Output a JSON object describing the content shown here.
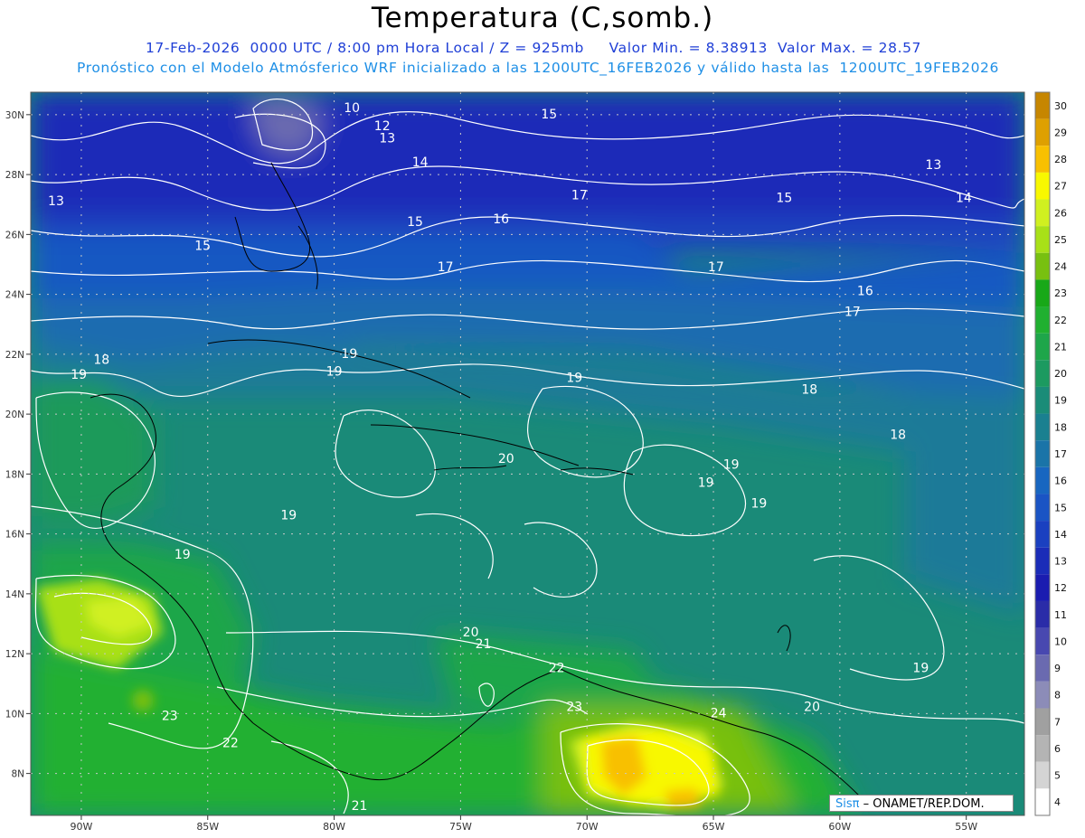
{
  "header": {
    "title": "Temperatura (C,somb.)",
    "date": "17-Feb-2026",
    "utc": "0000 UTC / 8:00 pm Hora Local / Z = 925mb",
    "min": "Valor Min. = 8.38913",
    "max": "Valor Max. = 28.57",
    "forecast": "Pronóstico con el Modelo Atmósferico WRF inicializado a las 1200UTC_16FEB2026 y válido hasta las  1200UTC_19FEB2026"
  },
  "axes": {
    "lon_labels": [
      "90W",
      "85W",
      "80W",
      "75W",
      "70W",
      "65W",
      "60W",
      "55W"
    ],
    "lat_labels": [
      "30N",
      "28N",
      "26N",
      "24N",
      "22N",
      "20N",
      "18N",
      "16N",
      "14N",
      "12N",
      "10N",
      "8N"
    ]
  },
  "colorbar": {
    "labels": [
      "30",
      "29",
      "28",
      "27",
      "26",
      "25",
      "24",
      "23",
      "22",
      "21",
      "20",
      "19",
      "18",
      "17",
      "16",
      "15",
      "14",
      "13",
      "12",
      "11",
      "10",
      "9",
      "8",
      "7",
      "6",
      "5",
      "4"
    ],
    "colors": [
      "#c68600",
      "#dea000",
      "#f8c000",
      "#f8f800",
      "#d0f020",
      "#a8e018",
      "#78c010",
      "#18a818",
      "#20b030",
      "#1ea64a",
      "#1c9a60",
      "#1a8c78",
      "#1a8090",
      "#1a74a8",
      "#1866c0",
      "#1a54c4",
      "#1a40c0",
      "#1a2cb8",
      "#1a1cb0",
      "#2a2ca8",
      "#4848b0",
      "#6a6ab0",
      "#8c8cb8",
      "#a0a0a0",
      "#b4b4b4",
      "#d4d4d4",
      "#ffffff"
    ]
  },
  "contour_labels": [
    {
      "text": "10",
      "lon": -79.3,
      "lat": 30.2
    },
    {
      "text": "12",
      "lon": -78.1,
      "lat": 29.6
    },
    {
      "text": "13",
      "lon": -77.9,
      "lat": 29.2
    },
    {
      "text": "14",
      "lon": -76.6,
      "lat": 28.4
    },
    {
      "text": "15",
      "lon": -71.5,
      "lat": 30.0
    },
    {
      "text": "13",
      "lon": -91.0,
      "lat": 27.1
    },
    {
      "text": "15",
      "lon": -85.2,
      "lat": 25.6
    },
    {
      "text": "15",
      "lon": -76.8,
      "lat": 26.4
    },
    {
      "text": "16",
      "lon": -73.4,
      "lat": 26.5
    },
    {
      "text": "17",
      "lon": -75.6,
      "lat": 24.9
    },
    {
      "text": "17",
      "lon": -70.3,
      "lat": 27.3
    },
    {
      "text": "15",
      "lon": -62.2,
      "lat": 27.2
    },
    {
      "text": "13",
      "lon": -56.3,
      "lat": 28.3
    },
    {
      "text": "14",
      "lon": -55.1,
      "lat": 27.2
    },
    {
      "text": "17",
      "lon": -64.9,
      "lat": 24.9
    },
    {
      "text": "16",
      "lon": -59.0,
      "lat": 24.1
    },
    {
      "text": "17",
      "lon": -59.5,
      "lat": 23.4
    },
    {
      "text": "18",
      "lon": -89.2,
      "lat": 21.8
    },
    {
      "text": "19",
      "lon": -90.1,
      "lat": 21.3
    },
    {
      "text": "19",
      "lon": -79.4,
      "lat": 22.0
    },
    {
      "text": "19",
      "lon": -80.0,
      "lat": 21.4
    },
    {
      "text": "19",
      "lon": -70.5,
      "lat": 21.2
    },
    {
      "text": "18",
      "lon": -61.2,
      "lat": 20.8
    },
    {
      "text": "18",
      "lon": -57.7,
      "lat": 19.3
    },
    {
      "text": "20",
      "lon": -73.2,
      "lat": 18.5
    },
    {
      "text": "19",
      "lon": -64.3,
      "lat": 18.3
    },
    {
      "text": "19",
      "lon": -65.3,
      "lat": 17.7
    },
    {
      "text": "19",
      "lon": -63.2,
      "lat": 17.0
    },
    {
      "text": "19",
      "lon": -81.8,
      "lat": 16.6
    },
    {
      "text": "19",
      "lon": -86.0,
      "lat": 15.3
    },
    {
      "text": "20",
      "lon": -74.6,
      "lat": 12.7
    },
    {
      "text": "21",
      "lon": -74.1,
      "lat": 12.3
    },
    {
      "text": "22",
      "lon": -71.2,
      "lat": 11.5
    },
    {
      "text": "23",
      "lon": -70.5,
      "lat": 10.2
    },
    {
      "text": "24",
      "lon": -64.8,
      "lat": 10.0
    },
    {
      "text": "20",
      "lon": -61.1,
      "lat": 10.2
    },
    {
      "text": "19",
      "lon": -56.8,
      "lat": 11.5
    },
    {
      "text": "23",
      "lon": -86.5,
      "lat": 9.9
    },
    {
      "text": "22",
      "lon": -84.1,
      "lat": 9.0
    },
    {
      "text": "21",
      "lon": -79.0,
      "lat": 6.9
    }
  ],
  "credit": {
    "brand": "Sisπ",
    "text": "– ONAMET/REP.DOM."
  }
}
